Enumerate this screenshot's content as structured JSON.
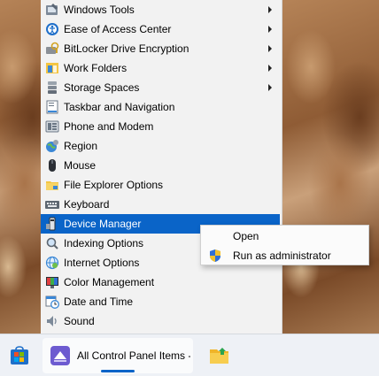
{
  "menu": {
    "items": [
      {
        "label": "Windows Tools",
        "icon": "windows-tools-icon",
        "submenu": true
      },
      {
        "label": "Ease of Access Center",
        "icon": "ease-of-access-icon",
        "submenu": true
      },
      {
        "label": "BitLocker Drive Encryption",
        "icon": "bitlocker-icon",
        "submenu": true
      },
      {
        "label": "Work Folders",
        "icon": "work-folders-icon",
        "submenu": true
      },
      {
        "label": "Storage Spaces",
        "icon": "storage-spaces-icon",
        "submenu": true
      },
      {
        "label": "Taskbar and Navigation",
        "icon": "taskbar-navigation-icon",
        "submenu": false
      },
      {
        "label": "Phone and Modem",
        "icon": "phone-modem-icon",
        "submenu": false
      },
      {
        "label": "Region",
        "icon": "region-icon",
        "submenu": false
      },
      {
        "label": "Mouse",
        "icon": "mouse-icon",
        "submenu": false
      },
      {
        "label": "File Explorer Options",
        "icon": "file-explorer-options-icon",
        "submenu": false
      },
      {
        "label": "Keyboard",
        "icon": "keyboard-icon",
        "submenu": false
      },
      {
        "label": "Device Manager",
        "icon": "device-manager-icon",
        "submenu": false,
        "selected": true
      },
      {
        "label": "Indexing Options",
        "icon": "indexing-options-icon",
        "submenu": false
      },
      {
        "label": "Internet Options",
        "icon": "internet-options-icon",
        "submenu": false
      },
      {
        "label": "Color Management",
        "icon": "color-management-icon",
        "submenu": false
      },
      {
        "label": "Date and Time",
        "icon": "date-time-icon",
        "submenu": false
      },
      {
        "label": "Sound",
        "icon": "sound-icon",
        "submenu": false
      }
    ]
  },
  "context_menu": {
    "items": [
      {
        "label": "Open",
        "icon": ""
      },
      {
        "label": "Run as administrator",
        "icon": "uac-shield-icon"
      }
    ]
  },
  "taskbar": {
    "store_icon": "microsoft-store-icon",
    "active_app": {
      "label": "All Control Panel Items -",
      "icon": "control-panel-icon"
    },
    "folder_icon": "file-explorer-icon"
  },
  "colors": {
    "selection": "#0a64c8",
    "menu_background": "#f2f2f2",
    "taskbar_background": "#eef1f6"
  }
}
